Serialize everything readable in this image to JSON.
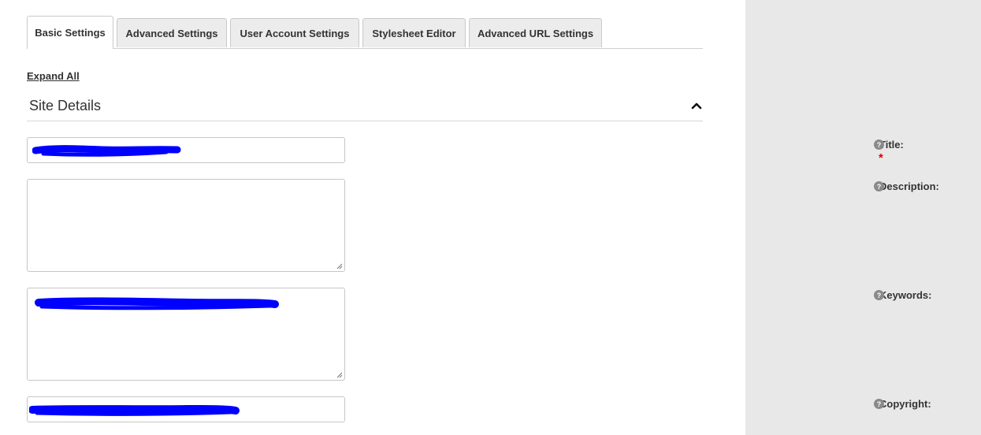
{
  "tabs": [
    {
      "label": "Basic Settings",
      "active": true
    },
    {
      "label": "Advanced Settings",
      "active": false
    },
    {
      "label": "User Account Settings",
      "active": false
    },
    {
      "label": "Stylesheet Editor",
      "active": false
    },
    {
      "label": "Advanced URL Settings",
      "active": false
    }
  ],
  "expand_all_label": "Expand All",
  "section": {
    "title": "Site Details",
    "collapse_icon": "chevron-up-icon"
  },
  "fields": {
    "title": {
      "label": "Title:",
      "required_mark": "*"
    },
    "description": {
      "label": "Description:"
    },
    "keywords": {
      "label": "Keywords:"
    },
    "copyright": {
      "label": "Copyright:"
    }
  },
  "colors": {
    "sidebar_bg": "#e8e8e8",
    "redaction": "#0000ff",
    "required": "#e00000"
  }
}
